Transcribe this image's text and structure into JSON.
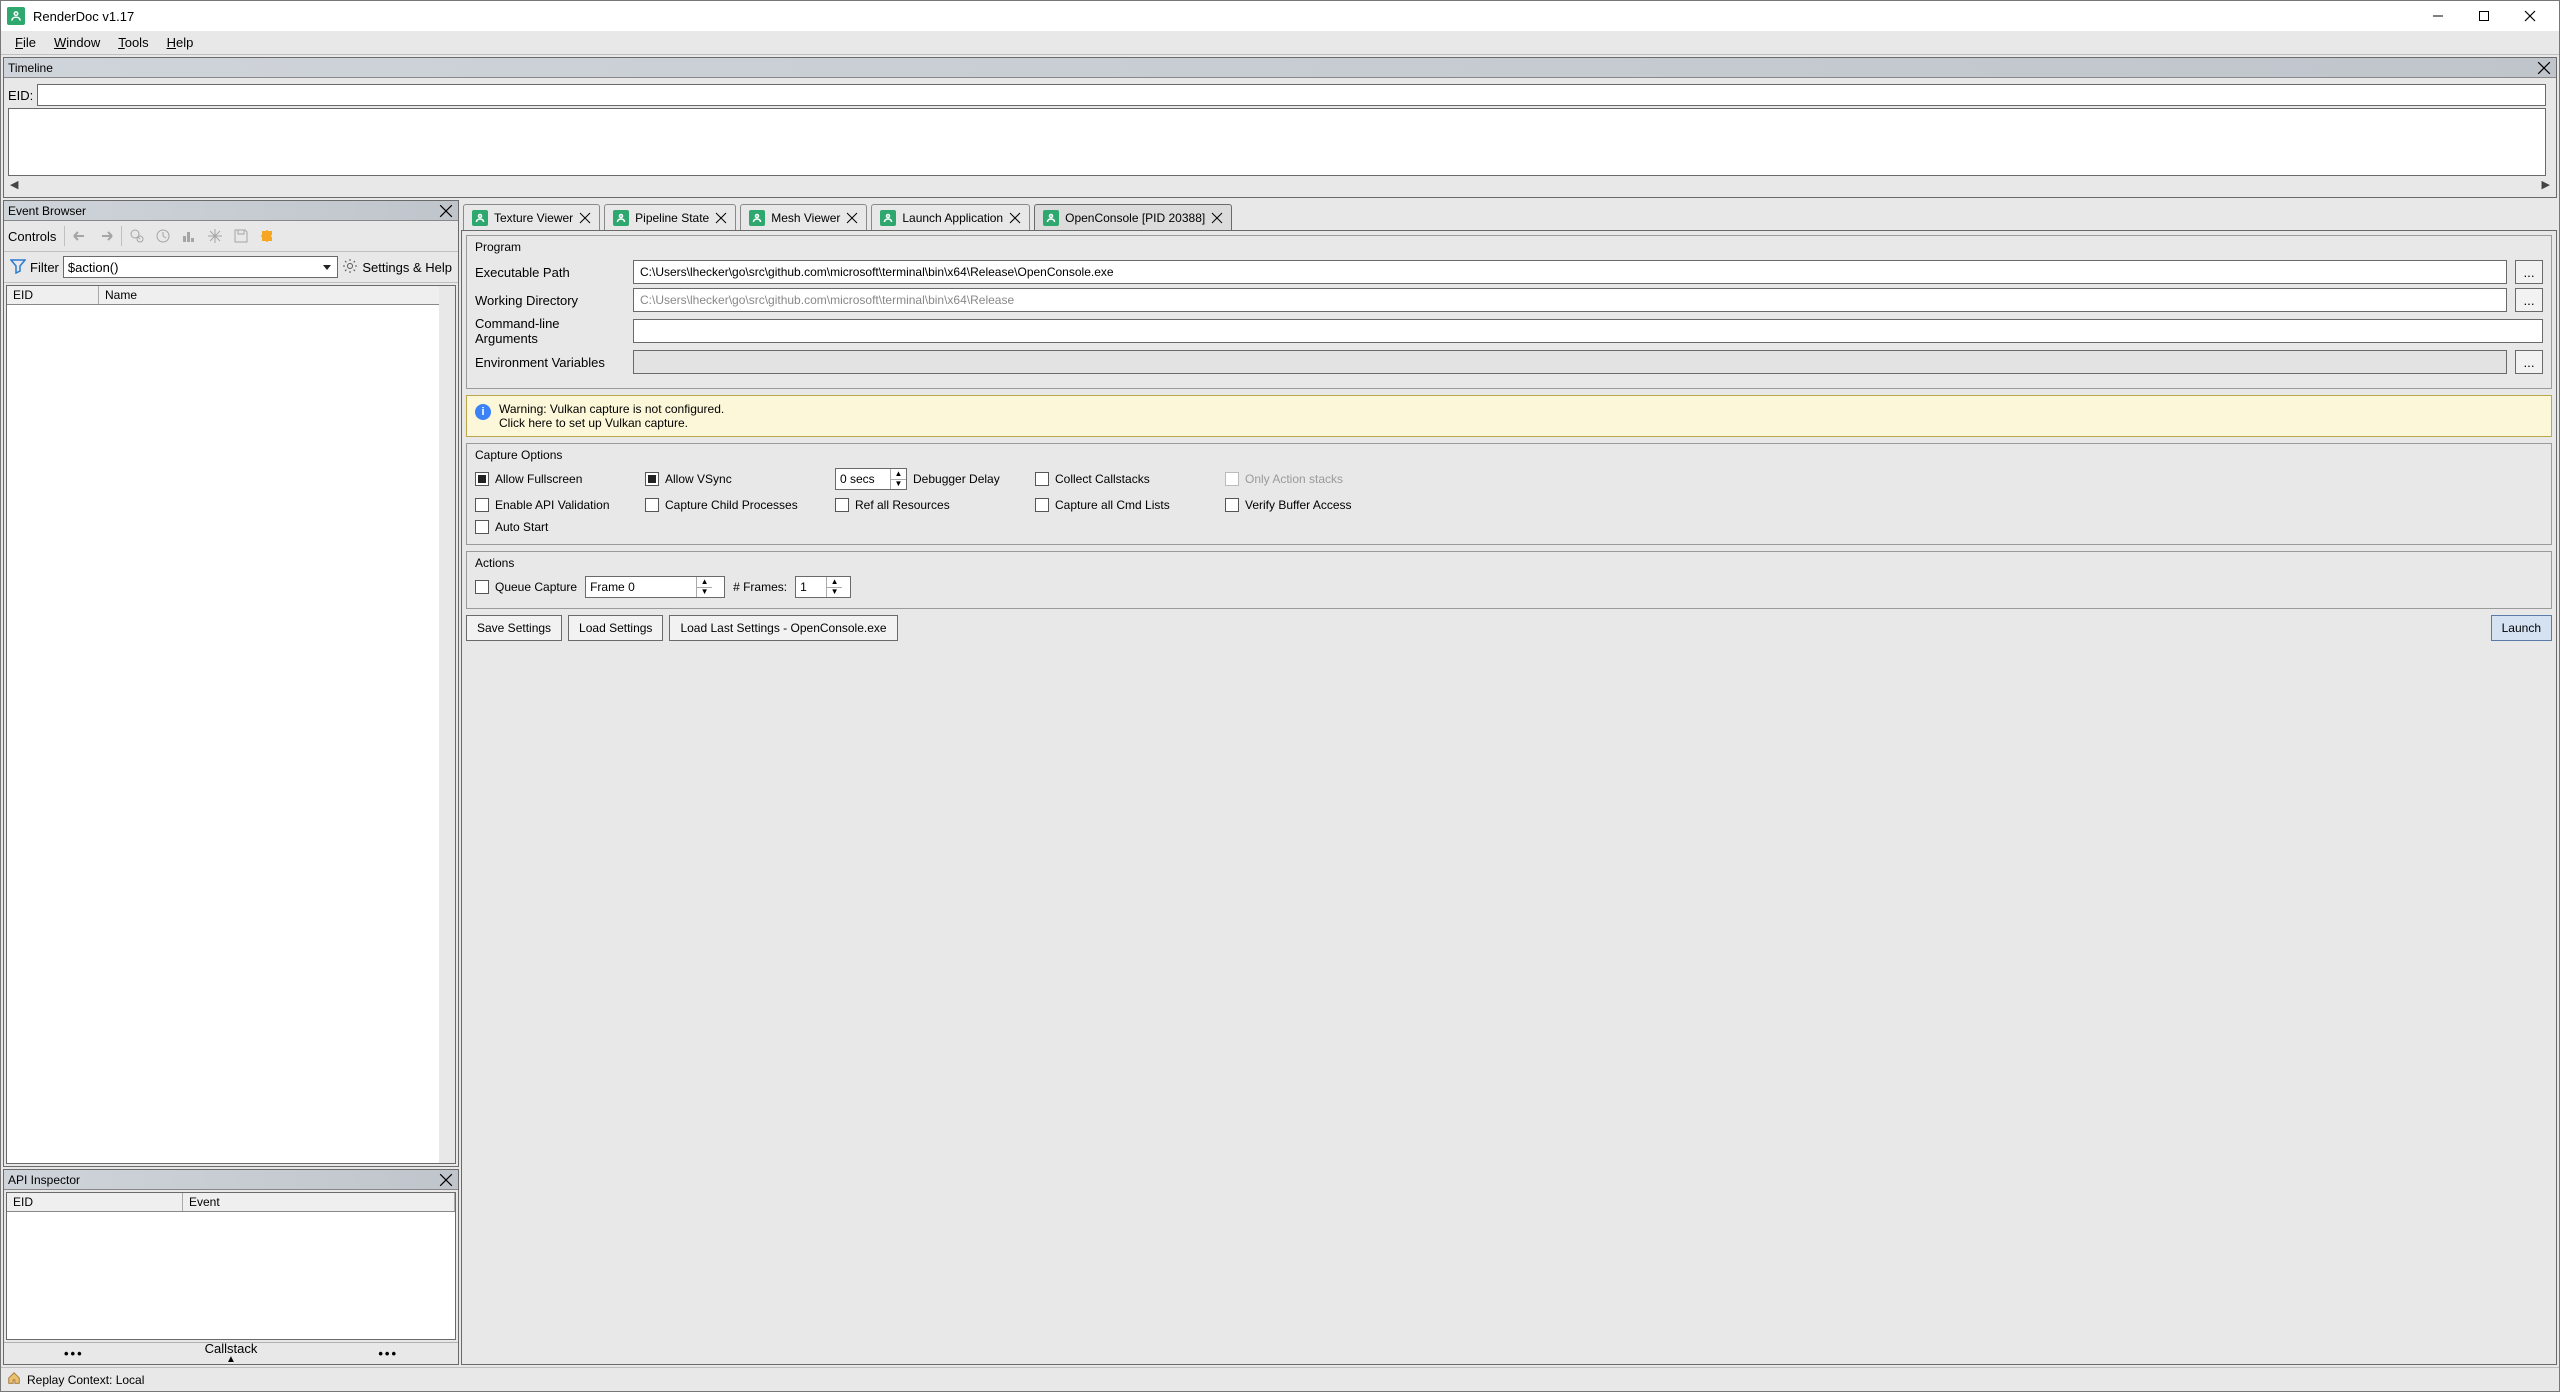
{
  "titlebar": {
    "title": "RenderDoc v1.17"
  },
  "menubar": {
    "file": "File",
    "window": "Window",
    "tools": "Tools",
    "help": "Help"
  },
  "timeline": {
    "title": "Timeline",
    "eid_label": "EID:",
    "eid_value": ""
  },
  "event_browser": {
    "title": "Event Browser",
    "controls_label": "Controls",
    "filter_label": "Filter",
    "filter_value": "$action()",
    "settings_label": "Settings & Help",
    "col_eid": "EID",
    "col_name": "Name"
  },
  "api_inspector": {
    "title": "API Inspector",
    "col_eid": "EID",
    "col_event": "Event",
    "callstack": "Callstack"
  },
  "statusbar": {
    "text": "Replay Context: Local"
  },
  "tabs": {
    "texture_viewer": "Texture Viewer",
    "pipeline_state": "Pipeline State",
    "mesh_viewer": "Mesh Viewer",
    "launch_application": "Launch Application",
    "open_console": "OpenConsole [PID 20388]"
  },
  "program": {
    "title": "Program",
    "exe_label": "Executable Path",
    "exe_value": "C:\\Users\\lhecker\\go\\src\\github.com\\microsoft\\terminal\\bin\\x64\\Release\\OpenConsole.exe",
    "wd_label": "Working Directory",
    "wd_placeholder": "C:\\Users\\lhecker\\go\\src\\github.com\\microsoft\\terminal\\bin\\x64\\Release",
    "args_label": "Command-line Arguments",
    "args_value": "",
    "env_label": "Environment Variables",
    "env_value": "",
    "browse": "..."
  },
  "warning": {
    "line1": "Warning: Vulkan capture is not configured.",
    "line2": "Click here to set up Vulkan capture."
  },
  "capture_options": {
    "title": "Capture Options",
    "allow_fullscreen": "Allow Fullscreen",
    "allow_vsync": "Allow VSync",
    "debugger_delay_value": "0 secs",
    "debugger_delay_label": "Debugger Delay",
    "collect_callstacks": "Collect Callstacks",
    "only_action_stacks": "Only Action stacks",
    "enable_api_validation": "Enable API Validation",
    "capture_child": "Capture Child Processes",
    "ref_all": "Ref all Resources",
    "capture_all_cmd": "Capture all Cmd Lists",
    "verify_buffer": "Verify Buffer Access",
    "auto_start": "Auto Start"
  },
  "actions": {
    "title": "Actions",
    "queue_capture": "Queue Capture",
    "frame_value": "Frame 0",
    "frames_label": "# Frames:",
    "frames_value": "1"
  },
  "buttons": {
    "save_settings": "Save Settings",
    "load_settings": "Load Settings",
    "load_last": "Load Last Settings - OpenConsole.exe",
    "launch": "Launch"
  }
}
